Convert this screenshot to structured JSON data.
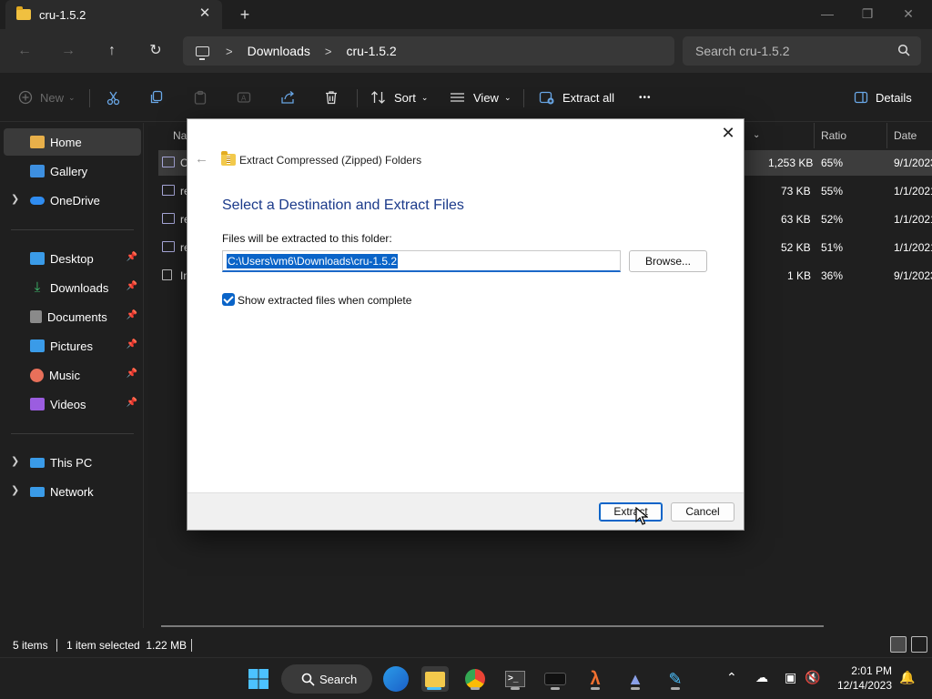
{
  "window": {
    "tab_title": "cru-1.5.2",
    "tab_close": "✕",
    "new_tab": "+"
  },
  "nav": {
    "breadcrumb": [
      "Downloads",
      "cru-1.5.2"
    ],
    "breadcrumb_sep": ">",
    "search_placeholder": "Search cru-1.5.2"
  },
  "toolbar": {
    "new_label": "New",
    "sort_label": "Sort",
    "view_label": "View",
    "extract_all_label": "Extract all",
    "more_label": "•••",
    "details_label": "Details"
  },
  "sidebar": {
    "items": [
      {
        "label": "Home",
        "icon": "home-icon",
        "color": "#e8b04a"
      },
      {
        "label": "Gallery",
        "icon": "gallery-icon",
        "color": "#3d8fe0"
      },
      {
        "label": "OneDrive",
        "icon": "cloud-icon",
        "color": "#2f8cf0"
      },
      {
        "label": "Desktop",
        "icon": "desktop-icon",
        "color": "#3a9be8"
      },
      {
        "label": "Downloads",
        "icon": "download-icon",
        "color": "#3fbf6f"
      },
      {
        "label": "Documents",
        "icon": "document-icon",
        "color": "#8a8a8a"
      },
      {
        "label": "Pictures",
        "icon": "pictures-icon",
        "color": "#3a9be8"
      },
      {
        "label": "Music",
        "icon": "music-icon",
        "color": "#e8705a"
      },
      {
        "label": "Videos",
        "icon": "videos-icon",
        "color": "#9b5de0"
      },
      {
        "label": "This PC",
        "icon": "pc-icon",
        "color": "#3a9be8"
      },
      {
        "label": "Network",
        "icon": "network-icon",
        "color": "#3a9be8"
      }
    ]
  },
  "filelist": {
    "headers": {
      "name": "Na",
      "ratio": "Ratio",
      "date": "Date mo"
    },
    "rows": [
      {
        "name": "C",
        "size": "1,253 KB",
        "ratio": "65%",
        "date": "9/1/2023"
      },
      {
        "name": "re",
        "size": "73 KB",
        "ratio": "55%",
        "date": "1/1/2021"
      },
      {
        "name": "re",
        "size": "63 KB",
        "ratio": "52%",
        "date": "1/1/2021"
      },
      {
        "name": "re",
        "size": "52 KB",
        "ratio": "51%",
        "date": "1/1/2021"
      },
      {
        "name": "In",
        "size": "1 KB",
        "ratio": "36%",
        "date": "9/1/2023"
      }
    ]
  },
  "status": {
    "items_count": "5 items",
    "selection": "1 item selected  1.22 MB"
  },
  "dialog": {
    "title": "Extract Compressed (Zipped) Folders",
    "heading": "Select a Destination and Extract Files",
    "folder_label": "Files will be extracted to this folder:",
    "folder_value": "C:\\Users\\vm6\\Downloads\\cru-1.5.2",
    "browse_label": "Browse...",
    "checkbox_label": "Show extracted files when complete",
    "checkbox_checked": true,
    "extract_label": "Extract",
    "cancel_label": "Cancel",
    "close_glyph": "✕",
    "back_glyph": "←"
  },
  "taskbar": {
    "search_label": "Search",
    "time": "2:01 PM",
    "date": "12/14/2023"
  },
  "colors": {
    "accent": "#0a64c8",
    "heading": "#1b3a8a",
    "taskbar_accent": "#4cc2ff"
  }
}
